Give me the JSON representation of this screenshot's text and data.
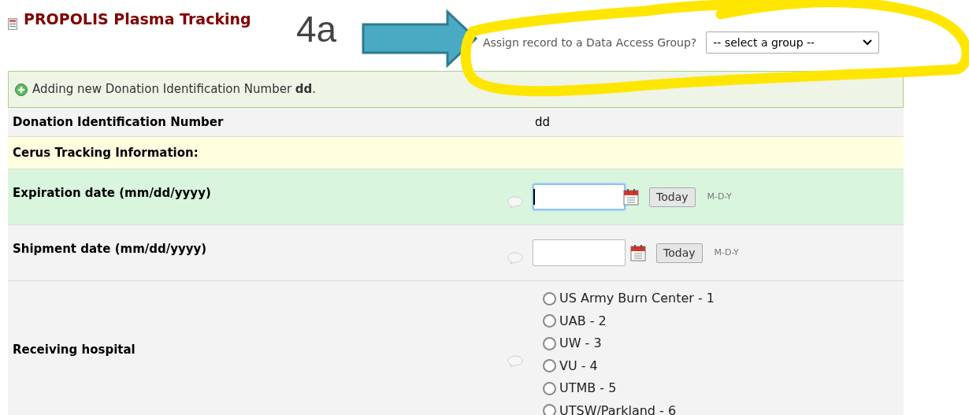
{
  "title": "PROPOLIS Plasma Tracking",
  "annotation": {
    "label": "4a"
  },
  "dag": {
    "label": "Assign record to a Data Access Group?",
    "value": "-- select a group --"
  },
  "notice": "Adding new Donation Identification Number **dd**.",
  "rows": [
    {
      "kind": "static",
      "label": "Donation Identification Number",
      "value": "dd"
    },
    {
      "kind": "header",
      "label": "Cerus Tracking Information:"
    },
    {
      "kind": "date",
      "label": "Expiration date (mm/dd/yyyy)",
      "focused": true,
      "button": "Today",
      "format": "M-D-Y"
    },
    {
      "kind": "date",
      "label": "Shipment date (mm/dd/yyyy)",
      "focused": false,
      "button": "Today",
      "format": "M-D-Y"
    },
    {
      "kind": "radio",
      "label": "Receiving hospital",
      "options": [
        {
          "label": "US Army Burn Center - 1",
          "selected": false
        },
        {
          "label": "UAB - 2",
          "selected": false
        },
        {
          "label": "UW - 3",
          "selected": false
        },
        {
          "label": "VU - 4",
          "selected": false
        },
        {
          "label": "UTMB - 5",
          "selected": false
        },
        {
          "label": "UTSW/Parkland - 6",
          "selected": false
        }
      ]
    }
  ]
}
